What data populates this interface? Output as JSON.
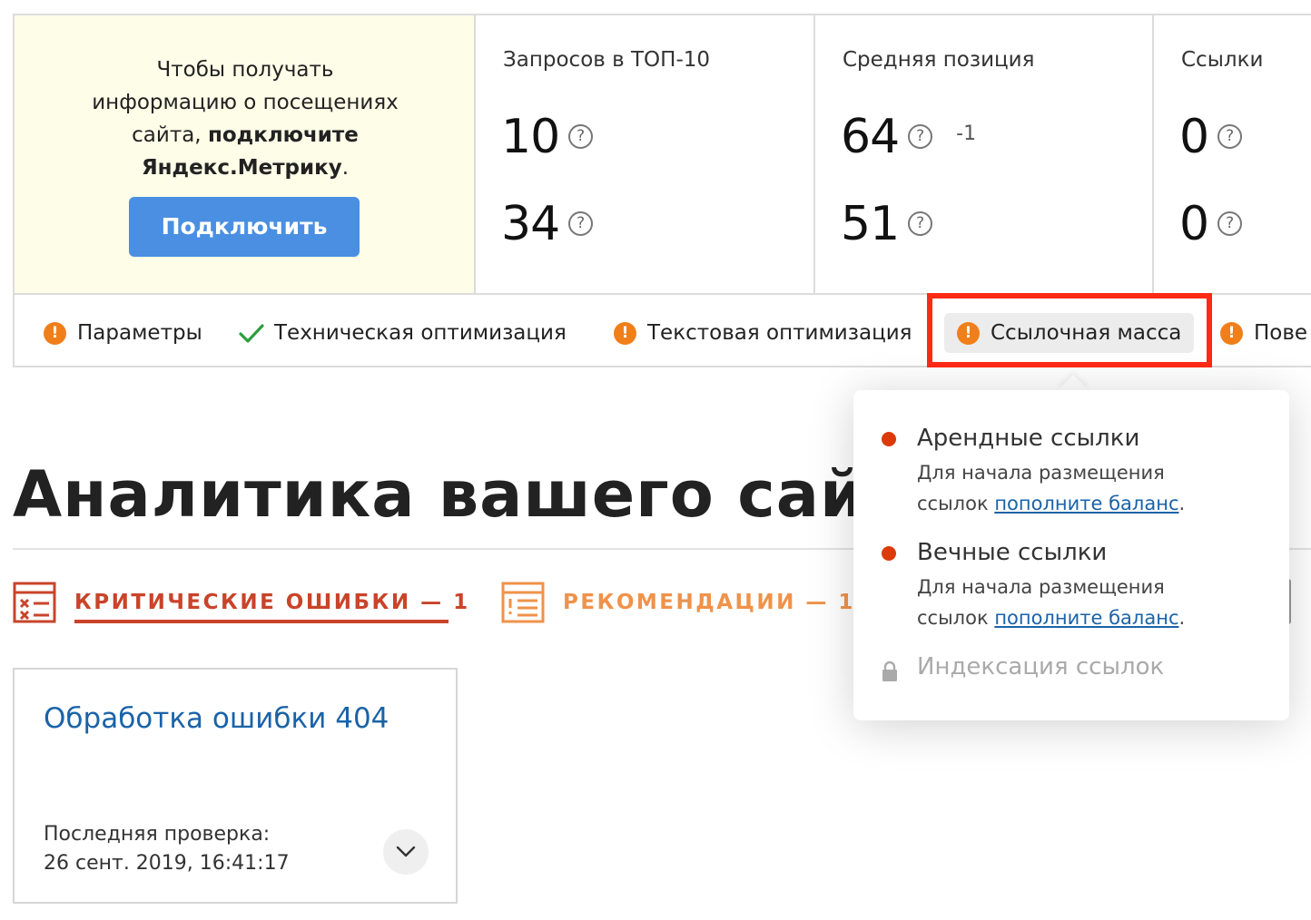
{
  "promo": {
    "line1": "Чтобы получать",
    "line2": "информацию о посещениях",
    "line3_prefix": "сайта, ",
    "line3_bold": "подключите",
    "line4_bold": "Яндекс.Метрику",
    "line4_suffix": ".",
    "button_label": "Подключить"
  },
  "stats": [
    {
      "title": "Запросов в ТОП-10",
      "value1": "10",
      "value2": "34",
      "delta": ""
    },
    {
      "title": "Средняя позиция",
      "value1": "64",
      "value2": "51",
      "delta": "-1"
    },
    {
      "title": "Ссылки",
      "value1": "0",
      "value2": "0",
      "delta": ""
    }
  ],
  "help_glyph": "?",
  "warn_glyph": "!",
  "tabs": [
    {
      "label": "Параметры",
      "status": "warning"
    },
    {
      "label": "Техническая оптимизация",
      "status": "ok"
    },
    {
      "label": "Текстовая оптимизация",
      "status": "warning"
    },
    {
      "label": "Ссылочная масса",
      "status": "warning",
      "active": true
    },
    {
      "label": "Пове",
      "status": "warning"
    }
  ],
  "analytics": {
    "title": "Аналитика вашего сайт",
    "categories": [
      {
        "label": "КРИТИЧЕСКИЕ ОШИБКИ — 1",
        "color": "#c9442a"
      },
      {
        "label": "РЕКОМЕНДАЦИИ — 1",
        "color": "#f0924a"
      }
    ],
    "card": {
      "title": "Обработка ошибки 404",
      "meta_label": "Последняя проверка:",
      "meta_date": "26 сент. 2019, 16:41:17"
    }
  },
  "popover": {
    "items": [
      {
        "title": "Арендные ссылки",
        "desc_line1": "Для начала размещения",
        "desc_prefix": "ссылок ",
        "link": "пополните баланс",
        "desc_suffix": "."
      },
      {
        "title": "Вечные ссылки",
        "desc_line1": "Для начала размещения",
        "desc_prefix": "ссылок ",
        "link": "пополните баланс",
        "desc_suffix": "."
      }
    ],
    "disabled_item": "Индексация ссылок"
  },
  "colors": {
    "accent_blue": "#4a8fe2",
    "warning_orange": "#f07f1a",
    "critical_red": "#c9442a",
    "link_blue": "#1a63a8",
    "highlight_red": "#ff2a15"
  }
}
